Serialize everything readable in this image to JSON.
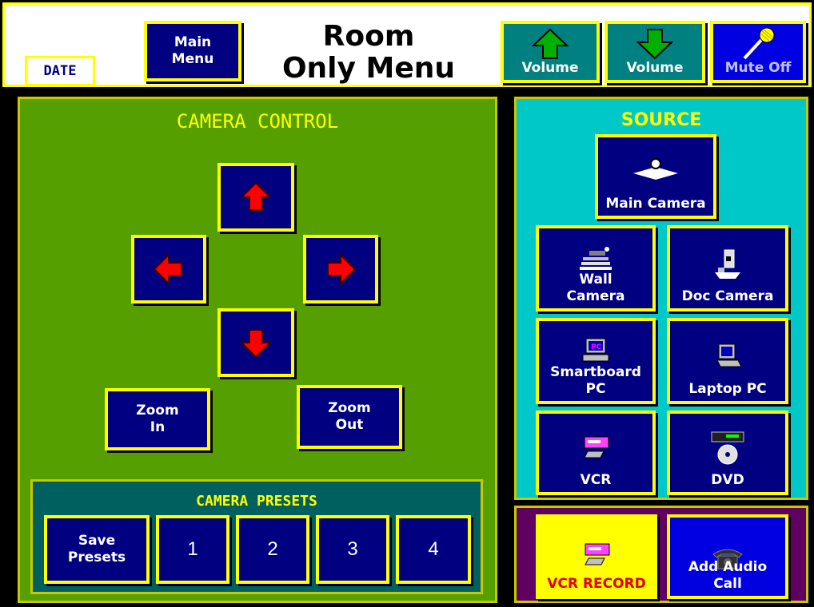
{
  "header": {
    "date_label": "DATE",
    "main_menu_label_1": "Main",
    "main_menu_label_2": "Menu",
    "title_line_1": "Room",
    "title_line_2": "Only Menu",
    "volume_up_label": "Volume",
    "volume_down_label": "Volume",
    "mute_label": "Mute Off"
  },
  "camera_control": {
    "title": "CAMERA  CONTROL",
    "zoom_in_1": "Zoom",
    "zoom_in_2": "In",
    "zoom_out_1": "Zoom",
    "zoom_out_2": "Out"
  },
  "presets": {
    "title": "CAMERA  PRESETS",
    "save_1": "Save",
    "save_2": "Presets",
    "p1": "1",
    "p2": "2",
    "p3": "3",
    "p4": "4"
  },
  "source": {
    "title": "SOURCE",
    "main_camera": "Main Camera",
    "wall_camera_1": "Wall",
    "wall_camera_2": "Camera",
    "doc_camera": "Doc Camera",
    "smartboard_1": "Smartboard",
    "smartboard_2": "PC",
    "laptop": "Laptop PC",
    "vcr": "VCR",
    "dvd": "DVD"
  },
  "record": {
    "vcr_record": "VCR RECORD",
    "audio_1": "Add Audio",
    "audio_2": "Call"
  },
  "colors": {
    "accent_border": "#ffff00",
    "button_navy": "#000080",
    "camera_panel_green": "#55a000",
    "source_panel_cyan": "#00c8c8",
    "record_panel_purple": "#600060"
  }
}
